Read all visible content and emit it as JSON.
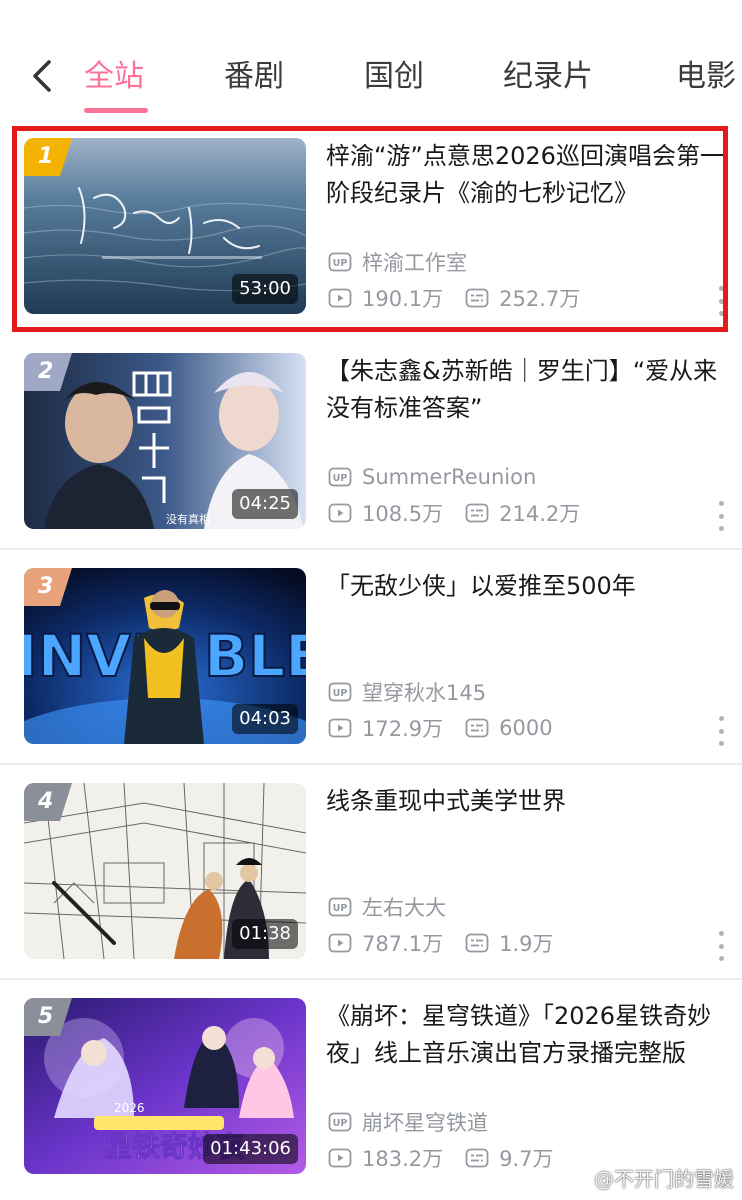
{
  "nav": {
    "back_icon": "chevron-left-icon",
    "tabs": [
      {
        "label": "全站",
        "active": true
      },
      {
        "label": "番剧",
        "active": false
      },
      {
        "label": "国创",
        "active": false
      },
      {
        "label": "纪录片",
        "active": false
      },
      {
        "label": "电影",
        "active": false
      }
    ],
    "accent_color": "#fb7299"
  },
  "videos": [
    {
      "rank": "1",
      "title": "梓渝“游”点意思2026巡回演唱会第一阶段纪录片《渝的七秒记忆》",
      "uploader": "梓渝工作室",
      "views": "190.1万",
      "danmaku": "252.7万",
      "duration": "53:00",
      "highlighted": true,
      "rank_color": "#f5b301"
    },
    {
      "rank": "2",
      "title": "【朱志鑫&苏新皓｜罗生门】“爱从来没有标准答案”",
      "uploader": "SummerReunion",
      "views": "108.5万",
      "danmaku": "214.2万",
      "duration": "04:25",
      "highlighted": false,
      "rank_color": "#9fa8c4"
    },
    {
      "rank": "3",
      "title": "「无敌少侠」以爱推至500年",
      "uploader": "望穿秋水145",
      "views": "172.9万",
      "danmaku": "6000",
      "duration": "04:03",
      "highlighted": false,
      "rank_color": "#e8a27c"
    },
    {
      "rank": "4",
      "title": "线条重现中式美学世界",
      "uploader": "左右大大",
      "views": "787.1万",
      "danmaku": "1.9万",
      "duration": "01:38",
      "highlighted": false,
      "rank_color": "#8a8f99"
    },
    {
      "rank": "5",
      "title": "《崩坏：星穹铁道》「2026星铁奇妙夜」线上音乐演出官方录播完整版",
      "uploader": "崩坏星穹铁道",
      "views": "183.2万",
      "danmaku": "9.7万",
      "duration": "01:43:06",
      "highlighted": false,
      "rank_color": "#8a8f99"
    }
  ],
  "watermark": "@不开门的雪媛"
}
